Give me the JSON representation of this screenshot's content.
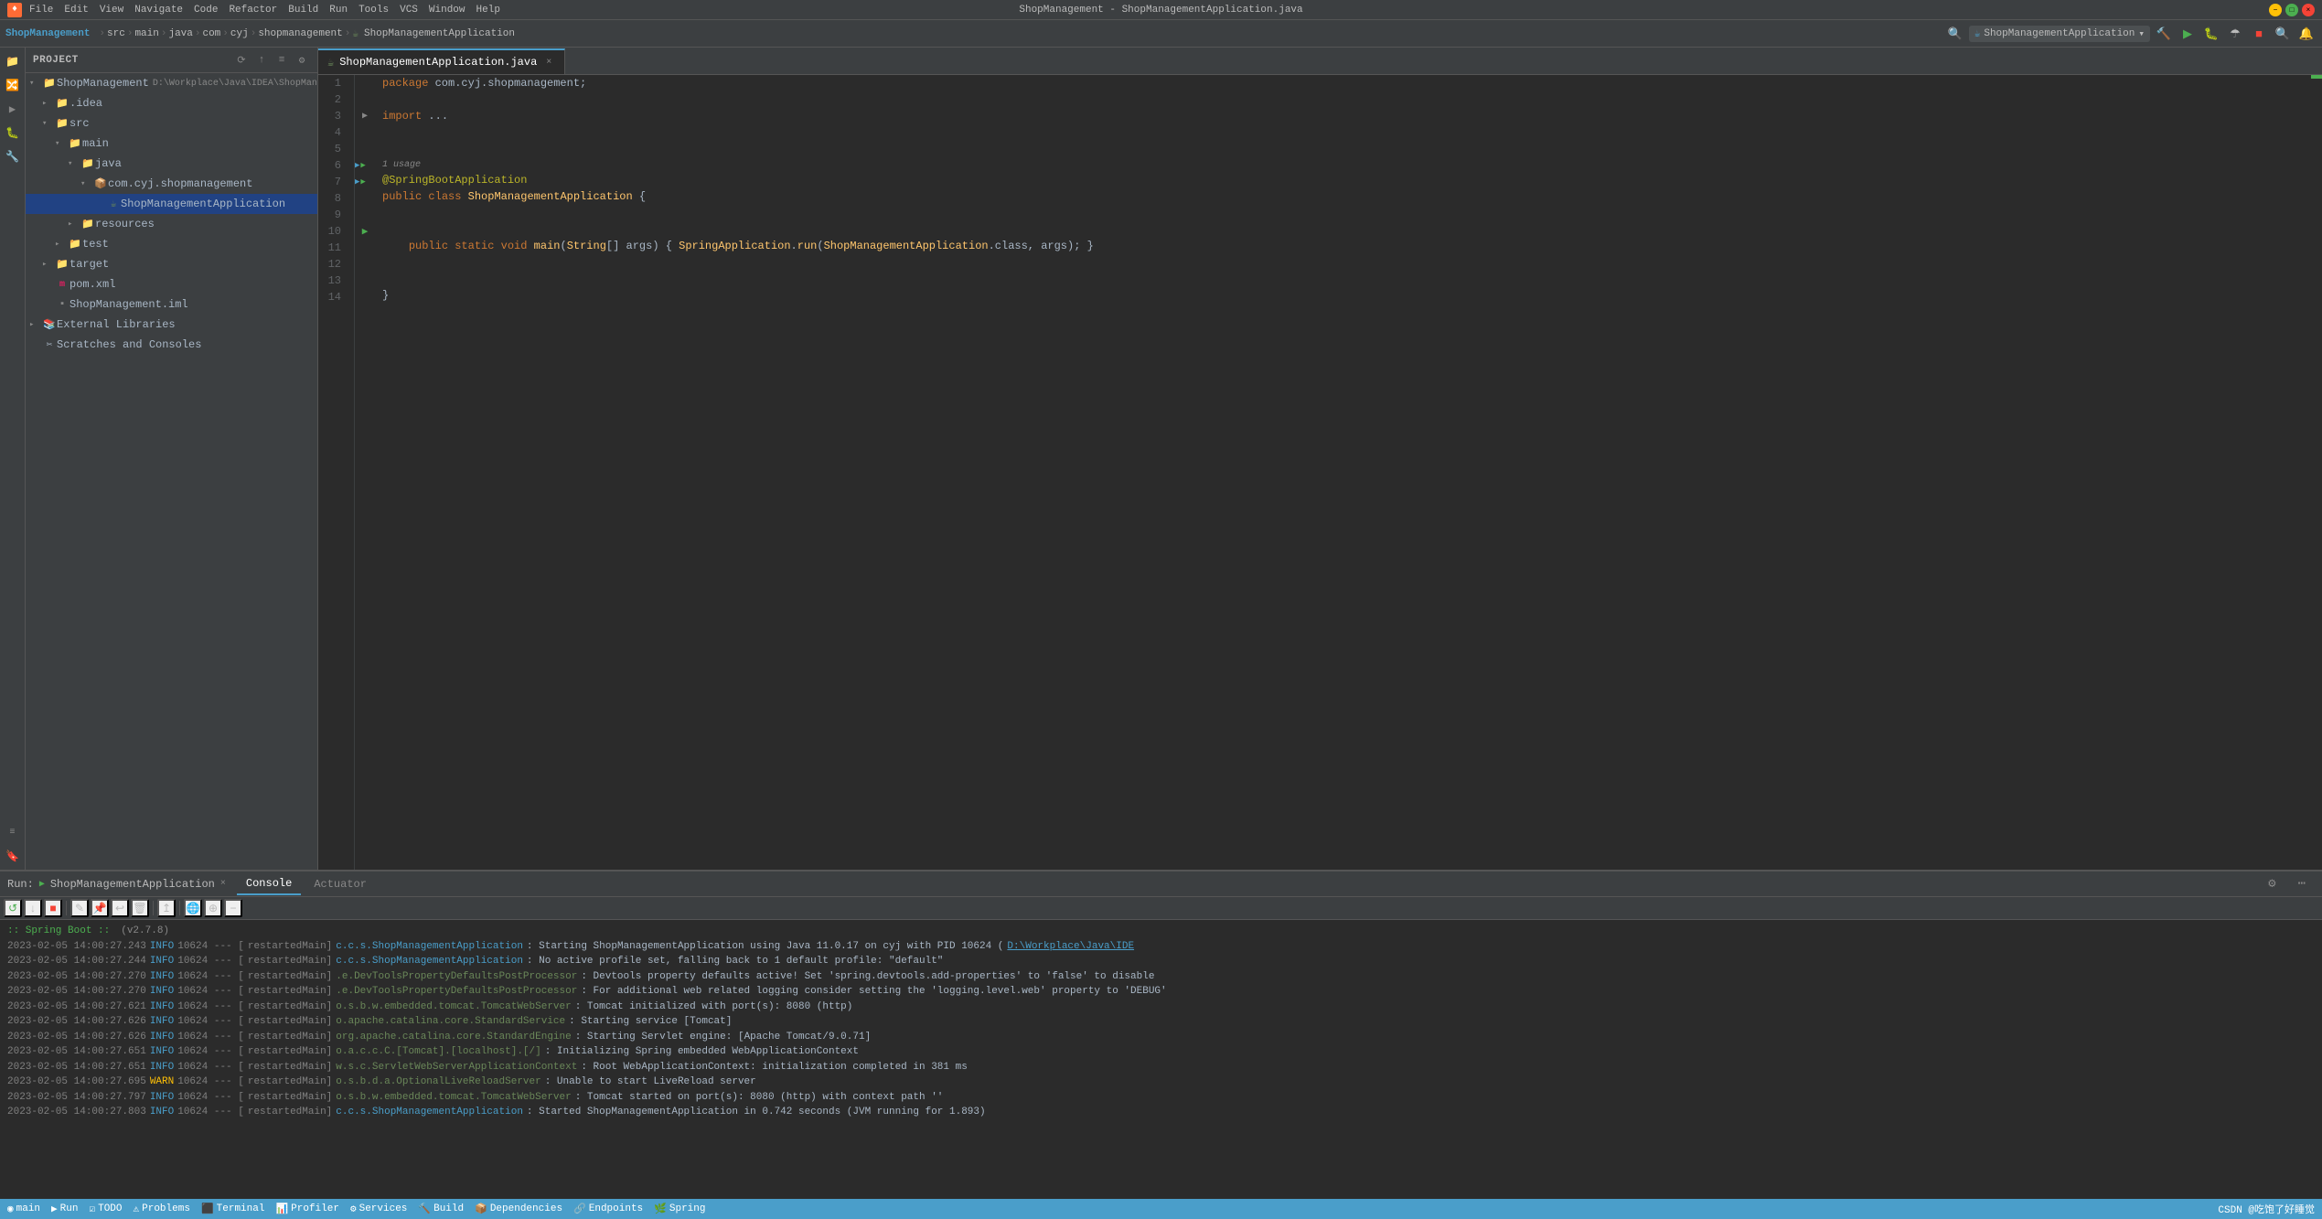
{
  "titleBar": {
    "logo": "♦",
    "menu": [
      "File",
      "Edit",
      "View",
      "Navigate",
      "Code",
      "Refactor",
      "Build",
      "Run",
      "Tools",
      "VCS",
      "Window",
      "Help"
    ],
    "title": "ShopManagement - ShopManagementApplication.java",
    "controls": [
      "−",
      "□",
      "×"
    ]
  },
  "navbar": {
    "brand": "ShopManagement",
    "breadcrumb": [
      "src",
      "main",
      "java",
      "com",
      "cyj",
      "shopmanagement"
    ],
    "fileIcon": "☕",
    "fileName": "ShopManagementApplication",
    "runConfig": "ShopManagementApplication"
  },
  "sidebar": {
    "title": "Project",
    "iconSync": "⟳",
    "iconCollapse": "↑",
    "iconConfig": "⚙",
    "iconSettings": "⚙",
    "tree": [
      {
        "indent": 0,
        "arrow": "▾",
        "icon": "📁",
        "label": "ShopManagement",
        "sublabel": "D:\\Workplace\\Java\\IDEA\\ShopManagement",
        "type": "root",
        "expanded": true
      },
      {
        "indent": 1,
        "arrow": "▸",
        "icon": "📁",
        "label": ".idea",
        "type": "dir",
        "expanded": false
      },
      {
        "indent": 1,
        "arrow": "▾",
        "icon": "📁",
        "label": "src",
        "type": "dir",
        "expanded": true
      },
      {
        "indent": 2,
        "arrow": "▾",
        "icon": "📁",
        "label": "main",
        "type": "dir",
        "expanded": true
      },
      {
        "indent": 3,
        "arrow": "▾",
        "icon": "📁",
        "label": "java",
        "type": "dir",
        "expanded": true
      },
      {
        "indent": 4,
        "arrow": "▾",
        "icon": "📦",
        "label": "com.cyj.shopmanagement",
        "type": "package",
        "expanded": true
      },
      {
        "indent": 5,
        "arrow": "",
        "icon": "☕",
        "label": "ShopManagementApplication",
        "type": "file",
        "selected": true
      },
      {
        "indent": 3,
        "arrow": "▸",
        "icon": "📁",
        "label": "resources",
        "type": "dir",
        "expanded": false
      },
      {
        "indent": 2,
        "arrow": "▸",
        "icon": "📁",
        "label": "test",
        "type": "dir",
        "expanded": false
      },
      {
        "indent": 1,
        "arrow": "▸",
        "icon": "📁",
        "label": "target",
        "type": "dir",
        "expanded": false
      },
      {
        "indent": 1,
        "arrow": "",
        "icon": "m",
        "label": "pom.xml",
        "type": "file"
      },
      {
        "indent": 1,
        "arrow": "",
        "icon": "▪",
        "label": "ShopManagement.iml",
        "type": "file"
      },
      {
        "indent": 0,
        "arrow": "▸",
        "icon": "📚",
        "label": "External Libraries",
        "type": "dir",
        "expanded": false
      },
      {
        "indent": 0,
        "arrow": "",
        "icon": "✂",
        "label": "Scratches and Consoles",
        "type": "file"
      }
    ]
  },
  "editor": {
    "tabs": [
      {
        "label": "ShopManagementApplication.java",
        "icon": "☕",
        "active": true,
        "modified": false
      }
    ],
    "lines": [
      {
        "num": 1,
        "tokens": [
          {
            "t": "package ",
            "c": "kw"
          },
          {
            "t": "com.cyj.shopmanagement",
            "c": "pkg"
          },
          {
            "t": ";",
            "c": "punc"
          }
        ]
      },
      {
        "num": 2,
        "tokens": []
      },
      {
        "num": 3,
        "tokens": [
          {
            "t": "import ",
            "c": "kw"
          },
          {
            "t": "...",
            "c": "pkg"
          }
        ],
        "collapsed": true
      },
      {
        "num": 4,
        "tokens": []
      },
      {
        "num": 5,
        "tokens": []
      },
      {
        "num": 6,
        "gutter": "run",
        "tokens": [
          {
            "t": "@SpringBootApplication",
            "c": "ann"
          }
        ],
        "usageHint": "1 usage"
      },
      {
        "num": 7,
        "gutter": "run",
        "tokens": [
          {
            "t": "public ",
            "c": "kw"
          },
          {
            "t": "class ",
            "c": "kw"
          },
          {
            "t": "ShopManagementApplication ",
            "c": "cls-name"
          },
          {
            "t": "{",
            "c": "punc"
          }
        ]
      },
      {
        "num": 8,
        "tokens": []
      },
      {
        "num": 9,
        "tokens": []
      },
      {
        "num": 10,
        "gutter": "run",
        "tokens": [
          {
            "t": "    "
          },
          {
            "t": "public ",
            "c": "kw"
          },
          {
            "t": "static ",
            "c": "kw"
          },
          {
            "t": "void ",
            "c": "kw"
          },
          {
            "t": "main",
            "c": "method-call"
          },
          {
            "t": "(",
            "c": "punc"
          },
          {
            "t": "String",
            "c": "cls-name"
          },
          {
            "t": "[] args) { ",
            "c": "punc"
          },
          {
            "t": "SpringApplication",
            "c": "cls-name"
          },
          {
            "t": ".",
            "c": "dot"
          },
          {
            "t": "run",
            "c": "method-call"
          },
          {
            "t": "(",
            "c": "punc"
          },
          {
            "t": "ShopManagementApplication",
            "c": "cls-name"
          },
          {
            "t": ".class, args); }",
            "c": "punc"
          }
        ]
      },
      {
        "num": 11,
        "tokens": []
      },
      {
        "num": 12,
        "tokens": []
      },
      {
        "num": 13,
        "tokens": [
          {
            "t": "}",
            "c": "punc"
          }
        ]
      },
      {
        "num": 14,
        "tokens": []
      }
    ]
  },
  "bottomPanel": {
    "runTitle": "Run:",
    "runTabLabel": "ShopManagementApplication",
    "tabs": [
      {
        "label": "Console",
        "active": true
      },
      {
        "label": "Actuator",
        "active": false
      }
    ],
    "toolbar": {
      "buttons": [
        {
          "icon": "↺",
          "name": "restart",
          "color": "green"
        },
        {
          "icon": "↓",
          "name": "scroll-down"
        },
        {
          "icon": "▣",
          "name": "stop",
          "color": "red"
        },
        {
          "icon": "sep"
        },
        {
          "icon": "✎",
          "name": "edit-config"
        },
        {
          "icon": "⊞",
          "name": "pin"
        },
        {
          "icon": "≡",
          "name": "wrap"
        },
        {
          "icon": "✕",
          "name": "close-output"
        },
        {
          "icon": "sep"
        },
        {
          "icon": "↥",
          "name": "jump-up"
        },
        {
          "icon": "sep"
        },
        {
          "icon": "🌐",
          "name": "browser"
        },
        {
          "icon": "⊕",
          "name": "add"
        },
        {
          "icon": "−",
          "name": "remove"
        }
      ]
    },
    "logs": [
      {
        "timestamp": "2023-02-05 14:00:27.243",
        "level": "INFO",
        "pid": "10624",
        "thread": "restartedMain",
        "logger": "c.c.s.ShopManagementApplication",
        "loggerHighlight": true,
        "message": ": Starting ShopManagementApplication using Java 11.0.17 on cyj with PID 10624 (",
        "link": "D:\\Workplace\\Java\\IDE"
      },
      {
        "timestamp": "2023-02-05 14:00:27.244",
        "level": "INFO",
        "pid": "10624",
        "thread": "restartedMain",
        "logger": "c.c.s.ShopManagementApplication",
        "loggerHighlight": true,
        "message": ": No active profile set, falling back to 1 default profile: \"default\""
      },
      {
        "timestamp": "2023-02-05 14:00:27.270",
        "level": "INFO",
        "pid": "10624",
        "thread": "restartedMain",
        "logger": ".e.DevToolsPropertyDefaultsPostProcessor",
        "loggerHighlight": false,
        "message": ": Devtools property defaults active! Set 'spring.devtools.add-properties' to 'false' to disable"
      },
      {
        "timestamp": "2023-02-05 14:00:27.270",
        "level": "INFO",
        "pid": "10624",
        "thread": "restartedMain",
        "logger": ".e.DevToolsPropertyDefaultsPostProcessor",
        "loggerHighlight": false,
        "message": ": For additional web related logging consider setting the 'logging.level.web' property to 'DEBUG'"
      },
      {
        "timestamp": "2023-02-05 14:00:27.621",
        "level": "INFO",
        "pid": "10624",
        "thread": "restartedMain",
        "logger": "o.s.b.w.embedded.tomcat.TomcatWebServer",
        "loggerHighlight": false,
        "message": ": Tomcat initialized with port(s): 8080 (http)"
      },
      {
        "timestamp": "2023-02-05 14:00:27.626",
        "level": "INFO",
        "pid": "10624",
        "thread": "restartedMain",
        "logger": "o.apache.catalina.core.StandardService",
        "loggerHighlight": false,
        "message": ": Starting service [Tomcat]"
      },
      {
        "timestamp": "2023-02-05 14:00:27.626",
        "level": "INFO",
        "pid": "10624",
        "thread": "restartedMain",
        "logger": "org.apache.catalina.core.StandardEngine",
        "loggerHighlight": false,
        "message": ": Starting Servlet engine: [Apache Tomcat/9.0.71]"
      },
      {
        "timestamp": "2023-02-05 14:00:27.651",
        "level": "INFO",
        "pid": "10624",
        "thread": "restartedMain",
        "logger": "o.a.c.c.C.[Tomcat].[localhost].[/]",
        "loggerHighlight": false,
        "message": ": Initializing Spring embedded WebApplicationContext"
      },
      {
        "timestamp": "2023-02-05 14:00:27.651",
        "level": "INFO",
        "pid": "10624",
        "thread": "restartedMain",
        "logger": "w.s.c.ServletWebServerApplicationContext",
        "loggerHighlight": false,
        "message": ": Root WebApplicationContext: initialization completed in 381 ms"
      },
      {
        "timestamp": "2023-02-05 14:00:27.695",
        "level": "WARN",
        "pid": "10624",
        "thread": "restartedMain",
        "logger": "o.s.b.d.a.OptionalLiveReloadServer",
        "loggerHighlight": false,
        "message": ": Unable to start LiveReload server"
      },
      {
        "timestamp": "2023-02-05 14:00:27.797",
        "level": "INFO",
        "pid": "10624",
        "thread": "restartedMain",
        "logger": "o.s.b.w.embedded.tomcat.TomcatWebServer",
        "loggerHighlight": false,
        "message": ": Tomcat started on port(s): 8080 (http) with context path ''"
      },
      {
        "timestamp": "2023-02-05 14:00:27.803",
        "level": "INFO",
        "pid": "10624",
        "thread": "restartedMain",
        "logger": "c.c.s.ShopManagementApplication",
        "loggerHighlight": true,
        "message": ": Started ShopManagementApplication in 0.742 seconds (JVM running for 1.893)"
      }
    ],
    "springBootHeader": "(v2.7.8)"
  },
  "statusBar": {
    "left": [
      {
        "icon": "◉",
        "label": "main",
        "name": "vcs-branch"
      },
      {
        "icon": "",
        "label": "Run",
        "name": "run-indicator"
      },
      {
        "icon": "",
        "label": "TODO",
        "name": "todo"
      },
      {
        "icon": "",
        "label": "Problems",
        "name": "problems"
      },
      {
        "icon": "",
        "label": "Terminal",
        "name": "terminal"
      },
      {
        "icon": "",
        "label": "Profiler",
        "name": "profiler"
      },
      {
        "icon": "",
        "label": "Services",
        "name": "services"
      },
      {
        "icon": "",
        "label": "Build",
        "name": "build"
      },
      {
        "icon": "",
        "label": "Dependencies",
        "name": "dependencies"
      },
      {
        "icon": "",
        "label": "Endpoints",
        "name": "endpoints"
      },
      {
        "icon": "🌿",
        "label": "Spring",
        "name": "spring"
      }
    ],
    "right": [
      {
        "label": "CSDN @吃饱了好睡觉",
        "name": "csdn-label"
      }
    ]
  }
}
